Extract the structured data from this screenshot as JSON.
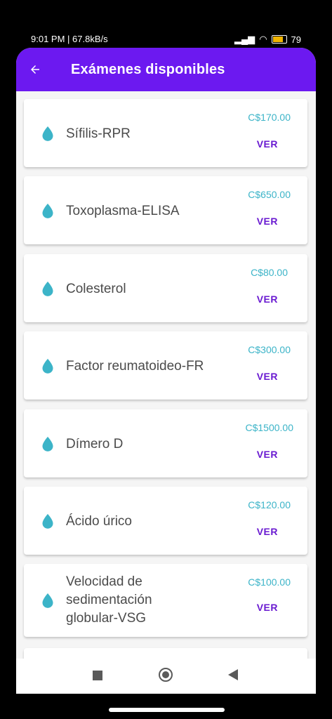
{
  "status_bar": {
    "left_text": "9:01 PM | 67.8kB/s",
    "battery": "79"
  },
  "app_bar": {
    "title": "Exámenes disponibles"
  },
  "exams": [
    {
      "name": "Sífilis-RPR",
      "price": "C$170.00",
      "action": "VER"
    },
    {
      "name": "Toxoplasma-ELISA",
      "price": "C$650.00",
      "action": "VER"
    },
    {
      "name": "Colesterol",
      "price": "C$80.00",
      "action": "VER"
    },
    {
      "name": "Factor reumatoideo-FR",
      "price": "C$300.00",
      "action": "VER"
    },
    {
      "name": "Dímero D",
      "price": "C$1500.00",
      "action": "VER"
    },
    {
      "name": "Ácido úrico",
      "price": "C$120.00",
      "action": "VER"
    },
    {
      "name": "Velocidad de sedimentación globular-VSG",
      "price": "C$100.00",
      "action": "VER"
    }
  ],
  "icons": {
    "exam_icon": "water-drop-icon",
    "back_icon": "arrow-back-icon"
  },
  "colors": {
    "accent": "#6c19f0",
    "price": "#3cb4c8",
    "action": "#6a1bd1"
  }
}
